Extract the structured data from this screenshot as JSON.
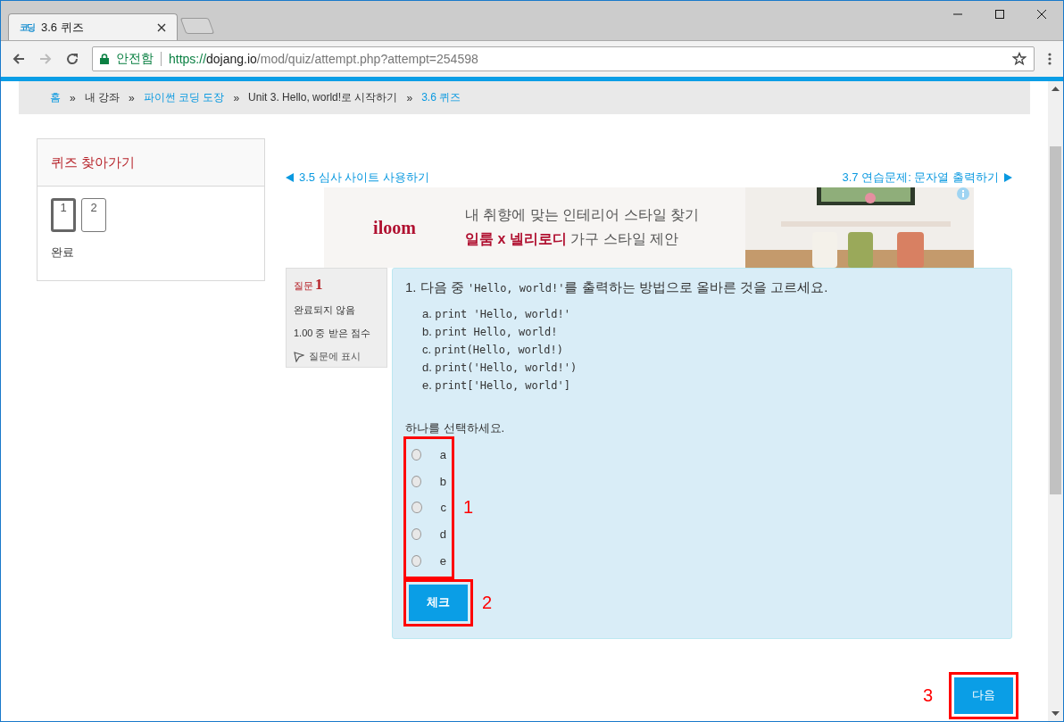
{
  "browser": {
    "tabs": [
      {
        "kind": "page",
        "title": "3.6 퀴즈",
        "favicon": "코딩",
        "selected": true
      },
      {
        "kind": "new",
        "selected": false
      }
    ],
    "security": "안전함",
    "url": {
      "scheme": "https://",
      "host": "dojang.io",
      "path": "/mod/quiz/attempt.php?attempt=254598"
    }
  },
  "breadcrumb": [
    {
      "label": "홈",
      "link": true
    },
    {
      "label": "내 강좌",
      "link": false
    },
    {
      "label": "파이썬 코딩 도장",
      "link": true
    },
    {
      "label": "Unit 3. Hello, world!로 시작하기",
      "link": false
    },
    {
      "label": "3.6 퀴즈",
      "link": true
    }
  ],
  "breadcrumb_separator": "»",
  "quiz_nav": {
    "title": "퀴즈 찾아가기",
    "questions": [
      {
        "label": "1",
        "selected": true
      },
      {
        "label": "2",
        "selected": false
      }
    ],
    "finish": "완료"
  },
  "prev_link": "3.5 심사 사이트 사용하기",
  "next_link": "3.7 연습문제: 문자열 출력하기",
  "ad": {
    "brand": "iloom",
    "line1": "내 취향에 맞는 인테리어 스타일 찾기",
    "highlight": "일룸 x 넬리로디",
    "line2_rest": " 가구 스타일 제안",
    "kind": "picture"
  },
  "question_info": {
    "label": "질문",
    "number": "1",
    "status": "완료되지 않음",
    "grade": "1.00 중 받은 점수",
    "flag": "질문에 표시"
  },
  "question": {
    "number": "1.",
    "before": "다음 중",
    "code": "'Hello, world!'",
    "after": "를 출력하는 방법으로 올바른 것을 고르세요.",
    "options": [
      {
        "letter": "a.",
        "code": "print 'Hello, world!'"
      },
      {
        "letter": "b.",
        "code": "print Hello, world!"
      },
      {
        "letter": "c.",
        "code": "print(Hello, world!)"
      },
      {
        "letter": "d.",
        "code": "print('Hello, world!')"
      },
      {
        "letter": "e.",
        "code": "print['Hello, world']"
      }
    ],
    "prompt": "하나를 선택하세요.",
    "choices": [
      {
        "label": "a",
        "checked": false
      },
      {
        "label": "b",
        "checked": false
      },
      {
        "label": "c",
        "checked": false
      },
      {
        "label": "d",
        "checked": false
      },
      {
        "label": "e",
        "checked": false
      }
    ],
    "choices_annotation": "1",
    "check_button": "체크",
    "check_annotation": "2"
  },
  "next_button": "다음",
  "next_annotation": "3"
}
